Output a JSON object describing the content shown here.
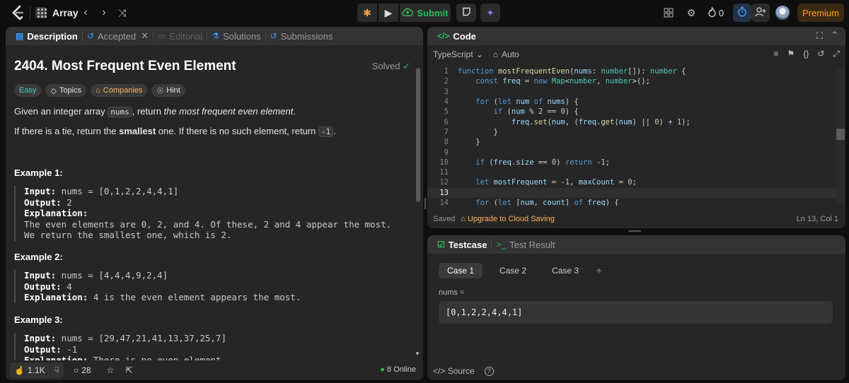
{
  "topbar": {
    "problem_list_label": "Array",
    "submit_label": "Submit",
    "streak_count": "0",
    "premium_label": "Premium"
  },
  "left_panel": {
    "tabs": [
      "Description",
      "Accepted",
      "Editorial",
      "Solutions",
      "Submissions"
    ],
    "title": "2404. Most Frequent Even Element",
    "status": "Solved",
    "tags": [
      "Easy",
      "Topics",
      "Companies",
      "Hint"
    ],
    "desc_p1_pre": "Given an integer array ",
    "desc_p1_code": "nums",
    "desc_p1_mid": ", return ",
    "desc_p1_em": "the most frequent even element",
    "desc_p1_end": ".",
    "desc_p2_pre": "If there is a tie, return the ",
    "desc_p2_bold": "smallest",
    "desc_p2_mid": " one. If there is no such element, return ",
    "desc_p2_code": "-1",
    "desc_p2_end": ".",
    "examples": [
      {
        "title": "Example 1:",
        "input_label": "Input:",
        "input": " nums = [0,1,2,2,4,4,1]",
        "output_label": "Output:",
        "output": " 2",
        "explanation_label": "Explanation:",
        "explanation_lines": [
          "The even elements are 0, 2, and 4. Of these, 2 and 4 appear the most.",
          "We return the smallest one, which is 2."
        ]
      },
      {
        "title": "Example 2:",
        "input_label": "Input:",
        "input": " nums = [4,4,4,9,2,4]",
        "output_label": "Output:",
        "output": " 4",
        "explanation_label": "Explanation:",
        "explanation": " 4 is the even element appears the most."
      },
      {
        "title": "Example 3:",
        "input_label": "Input:",
        "input": " nums = [29,47,21,41,13,37,25,7]",
        "output_label": "Output:",
        "output": " -1",
        "explanation_label": "Explanation:",
        "explanation": " There is no even element."
      }
    ],
    "footer": {
      "likes": "1.1K",
      "comments": "28",
      "online": "8 Online"
    }
  },
  "code_panel": {
    "tab_label": "Code",
    "language": "TypeScript",
    "mode": "Auto",
    "line_numbers": [
      "1",
      "2",
      "3",
      "4",
      "5",
      "6",
      "7",
      "8",
      "9",
      "10",
      "11",
      "12",
      "13",
      "14"
    ],
    "current_line": 13,
    "saved_label": "Saved",
    "upgrade_label": "Upgrade to Cloud Saving",
    "cursor_position": "Ln 13, Col 1"
  },
  "test_panel": {
    "tabs": [
      "Testcase",
      "Test Result"
    ],
    "cases": [
      "Case 1",
      "Case 2",
      "Case 3"
    ],
    "param_label": "nums =",
    "param_value": "[0,1,2,2,4,4,1]",
    "source_label": "Source"
  },
  "colors": {
    "accent_green": "#2cbb5d",
    "premium_orange": "#ffa116",
    "easy_teal": "#46c6c2",
    "background": "#0f0f0f",
    "panel": "#262626"
  }
}
